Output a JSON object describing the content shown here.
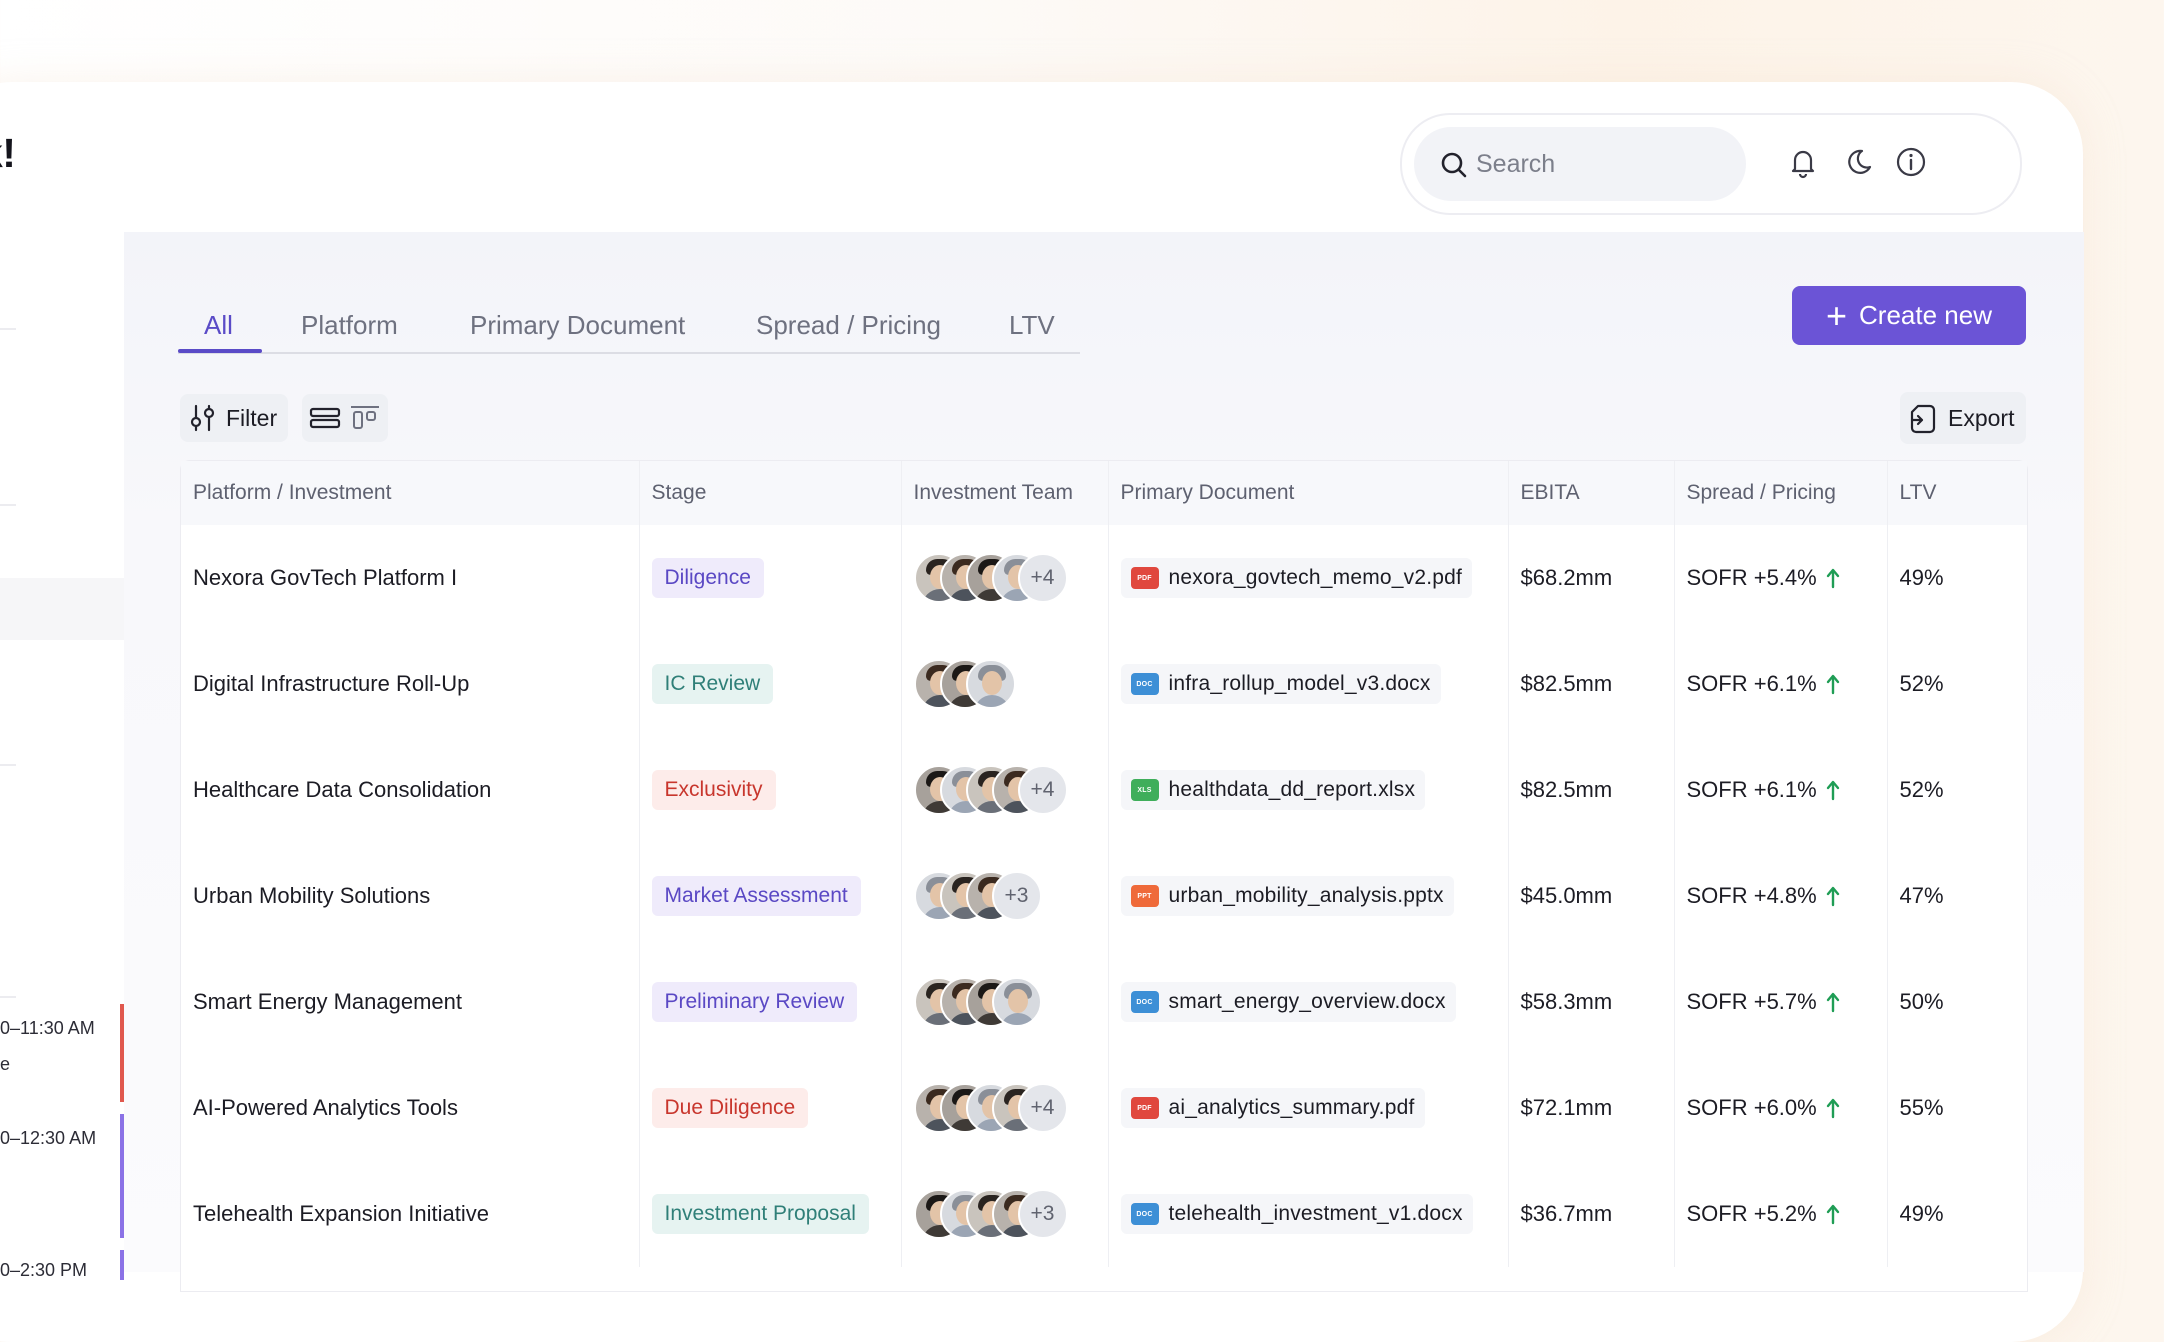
{
  "header": {
    "greeting": "k!",
    "search": {
      "placeholder": "Search"
    },
    "icons": [
      "bell-icon",
      "moon-icon",
      "info-icon"
    ]
  },
  "left_panel": {
    "events": [
      {
        "time": "0–11:30 AM",
        "sub": "e",
        "color": "#e0584e"
      },
      {
        "time": "0–12:30 AM",
        "sub": "",
        "color": "#8b72e6"
      },
      {
        "time": "0–2:30 PM",
        "sub": "",
        "color": "#8b72e6"
      }
    ]
  },
  "tabs": [
    {
      "label": "All",
      "active": true
    },
    {
      "label": "Platform",
      "active": false
    },
    {
      "label": "Primary Document",
      "active": false
    },
    {
      "label": "Spread / Pricing",
      "active": false
    },
    {
      "label": "LTV",
      "active": false
    }
  ],
  "toolbar": {
    "create_label": "Create new",
    "filter_label": "Filter",
    "export_label": "Export"
  },
  "table": {
    "columns": [
      "Platform / Investment",
      "Stage",
      "Investment Team",
      "Primary Document",
      "EBITA",
      "Spread / Pricing",
      "LTV"
    ],
    "rows": [
      {
        "platform": "Nexora GovTech Platform I",
        "stage": "Diligence",
        "stage_style": "purple",
        "team_more": "+4",
        "team_count": 4,
        "doc_type": "PDF",
        "doc": "nexora_govtech_memo_v2.pdf",
        "ebita": "$68.2mm",
        "spread": "SOFR +5.4%",
        "ltv": "49%"
      },
      {
        "platform": "Digital Infrastructure Roll-Up",
        "stage": "IC Review",
        "stage_style": "teal",
        "team_more": "",
        "team_count": 3,
        "doc_type": "DOC",
        "doc": "infra_rollup_model_v3.docx",
        "ebita": "$82.5mm",
        "spread": "SOFR +6.1%",
        "ltv": "52%"
      },
      {
        "platform": "Healthcare Data Consolidation",
        "stage": "Exclusivity",
        "stage_style": "red",
        "team_more": "+4",
        "team_count": 4,
        "doc_type": "XLS",
        "doc": "healthdata_dd_report.xlsx",
        "ebita": "$82.5mm",
        "spread": "SOFR +6.1%",
        "ltv": "52%"
      },
      {
        "platform": "Urban Mobility Solutions",
        "stage": "Market Assessment",
        "stage_style": "purple",
        "team_more": "+3",
        "team_count": 3,
        "doc_type": "PPT",
        "doc": "urban_mobility_analysis.pptx",
        "ebita": "$45.0mm",
        "spread": "SOFR +4.8%",
        "ltv": "47%"
      },
      {
        "platform": "Smart Energy Management",
        "stage": "Preliminary Review",
        "stage_style": "purple",
        "team_more": "",
        "team_count": 4,
        "doc_type": "DOC",
        "doc": "smart_energy_overview.docx",
        "ebita": "$58.3mm",
        "spread": "SOFR +5.7%",
        "ltv": "50%"
      },
      {
        "platform": "AI-Powered Analytics Tools",
        "stage": "Due Diligence",
        "stage_style": "red",
        "team_more": "+4",
        "team_count": 4,
        "doc_type": "PDF",
        "doc": "ai_analytics_summary.pdf",
        "ebita": "$72.1mm",
        "spread": "SOFR +6.0%",
        "ltv": "55%"
      },
      {
        "platform": "Telehealth Expansion Initiative",
        "stage": "Investment Proposal",
        "stage_style": "teal",
        "team_more": "+3",
        "team_count": 4,
        "doc_type": "DOC",
        "doc": "telehealth_investment_v1.docx",
        "ebita": "$36.7mm",
        "spread": "SOFR +5.2%",
        "ltv": "49%"
      }
    ]
  },
  "colors": {
    "accent": "#6b54d6",
    "tab_active": "#5a4bc7",
    "arrow_up": "#1f9d55",
    "pdf": "#e0483e",
    "doc": "#3d8fd6",
    "xls": "#3fae5b",
    "ppt": "#ef6a3a"
  }
}
